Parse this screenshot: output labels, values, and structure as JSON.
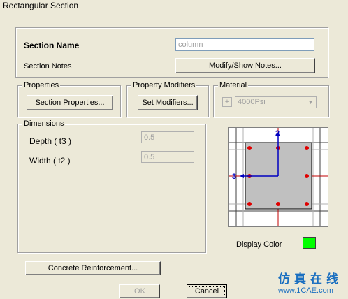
{
  "window": {
    "title": "Rectangular Section"
  },
  "section": {
    "name_label": "Section Name",
    "name_value": "column",
    "notes_label": "Section Notes",
    "notes_button": "Modify/Show Notes..."
  },
  "properties": {
    "legend": "Properties",
    "button": "Section Properties..."
  },
  "modifiers": {
    "legend": "Property Modifiers",
    "button": "Set Modifiers..."
  },
  "material": {
    "legend": "Material",
    "plus": "+",
    "selected": "4000Psi"
  },
  "dimensions": {
    "legend": "Dimensions",
    "depth_label": "Depth  ( t3 )",
    "depth_value": "0.5",
    "width_label": "Width  ( t2 )",
    "width_value": "0.5"
  },
  "preview": {
    "axis2_label": "2",
    "axis3_label": "3",
    "section_fill": "#c0c0c0",
    "rebar_color": "#e00000",
    "axis_color": "#0000c0"
  },
  "display_color": {
    "label": "Display Color",
    "value": "#00ff00"
  },
  "buttons": {
    "reinforcement": "Concrete Reinforcement...",
    "ok": "OK",
    "cancel": "Cancel"
  },
  "watermark": {
    "text": "仿真在线",
    "url": "www.1CAE.com"
  }
}
